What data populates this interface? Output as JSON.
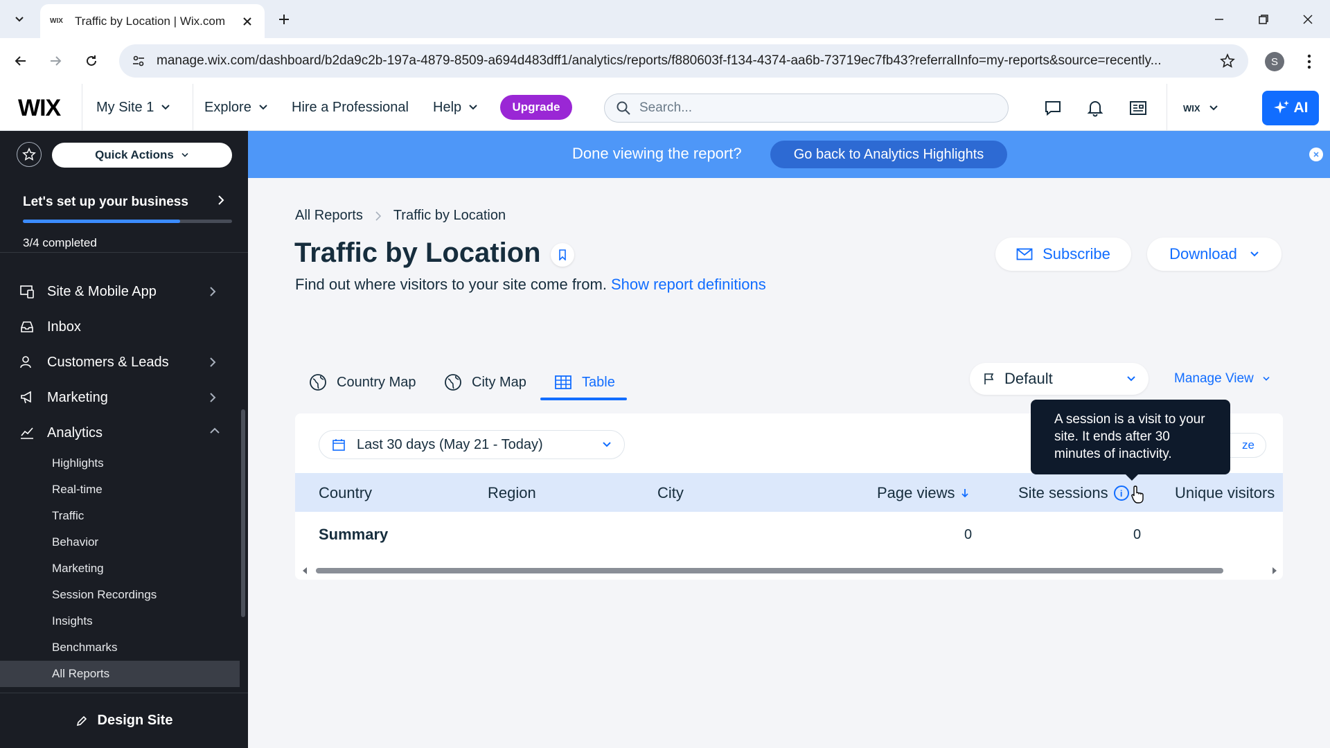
{
  "browser": {
    "tab_title": "Traffic by Location | Wix.com",
    "tab_favicon": "WIX",
    "url": "manage.wix.com/dashboard/b2da9c2b-197a-4879-8509-a694d483dff1/analytics/reports/f880603f-f134-4374-aa6b-73719ec7fb43?referralInfo=my-reports&source=recently...",
    "profile_initial": "S"
  },
  "topbar": {
    "logo": "WIX",
    "site_name": "My Site 1",
    "explore": "Explore",
    "hire": "Hire a Professional",
    "help": "Help",
    "upgrade": "Upgrade",
    "search_placeholder": "Search...",
    "account_label": "WIX",
    "ai_label": "AI"
  },
  "sidebar": {
    "quick_actions": "Quick Actions",
    "setup_title": "Let's set up your business",
    "setup_progress": 0.75,
    "setup_count": "3/4 completed",
    "items": [
      {
        "label": "Site & Mobile App",
        "icon": "site-icon"
      },
      {
        "label": "Inbox",
        "icon": "inbox-icon"
      },
      {
        "label": "Customers & Leads",
        "icon": "customers-icon"
      },
      {
        "label": "Marketing",
        "icon": "megaphone-icon"
      },
      {
        "label": "Analytics",
        "icon": "analytics-icon"
      }
    ],
    "analytics_sub": [
      "Highlights",
      "Real-time",
      "Traffic",
      "Behavior",
      "Marketing",
      "Session Recordings",
      "Insights",
      "Benchmarks",
      "All Reports"
    ],
    "active_sub": "All Reports",
    "design_site": "Design Site"
  },
  "banner": {
    "text": "Done viewing the report?",
    "button": "Go back to Analytics Highlights"
  },
  "report": {
    "breadcrumb_root": "All Reports",
    "breadcrumb_current": "Traffic by Location",
    "title": "Traffic by Location",
    "subtitle": "Find out where visitors to your site come from.",
    "definitions_link": "Show report definitions",
    "subscribe": "Subscribe",
    "download": "Download",
    "tabs": [
      "Country Map",
      "City Map",
      "Table"
    ],
    "active_tab": "Table",
    "view_select": "Default",
    "manage_view": "Manage View",
    "date_range": "Last 30 days (May 21 - Today)",
    "partial_button": "ze",
    "columns": [
      "Country",
      "Region",
      "City",
      "Page views",
      "Site sessions",
      "Unique visitors"
    ],
    "summary_label": "Summary",
    "summary_page_views": "0",
    "summary_site_sessions": "0",
    "tooltip": "A session is a visit to your site. It ends after 30 minutes of inactivity.",
    "accent": "#116dff"
  }
}
